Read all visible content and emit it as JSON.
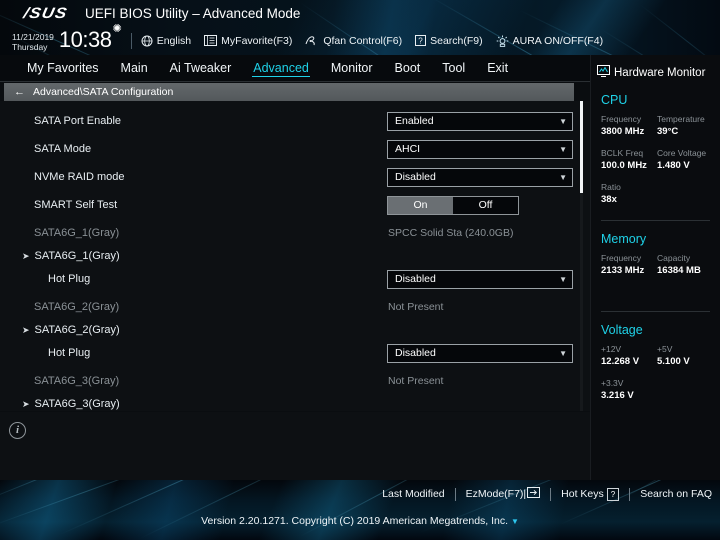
{
  "header": {
    "logo": "/SUS",
    "title": "UEFI BIOS Utility – Advanced Mode",
    "date": "11/21/2019",
    "weekday": "Thursday",
    "time": "10:38",
    "gear_icon": "gear-icon",
    "items": [
      {
        "icon": "globe-icon",
        "label": "English"
      },
      {
        "icon": "myfavorite-icon",
        "label": "MyFavorite(F3)"
      },
      {
        "icon": "qfan-icon",
        "label": "Qfan Control(F6)"
      },
      {
        "icon": "search-icon",
        "label": "Search(F9)"
      },
      {
        "icon": "aura-icon",
        "label": "AURA ON/OFF(F4)"
      }
    ]
  },
  "nav": {
    "tabs": [
      {
        "label": "My Favorites",
        "active": false
      },
      {
        "label": "Main",
        "active": false
      },
      {
        "label": "Ai Tweaker",
        "active": false
      },
      {
        "label": "Advanced",
        "active": true
      },
      {
        "label": "Monitor",
        "active": false
      },
      {
        "label": "Boot",
        "active": false
      },
      {
        "label": "Tool",
        "active": false
      },
      {
        "label": "Exit",
        "active": false
      }
    ],
    "accent": "#1fd2e8"
  },
  "breadcrumb": {
    "back_icon": "back-arrow-icon",
    "path": "Advanced\\SATA Configuration"
  },
  "settings": {
    "rows": [
      {
        "kind": "dropdown",
        "label": "SATA Port Enable",
        "value": "Enabled",
        "indent": 0,
        "dim": false
      },
      {
        "kind": "dropdown",
        "label": "SATA Mode",
        "value": "AHCI",
        "indent": 0,
        "dim": false
      },
      {
        "kind": "dropdown",
        "label": "NVMe RAID mode",
        "value": "Disabled",
        "indent": 0,
        "dim": false
      },
      {
        "kind": "toggle",
        "label": "SMART Self Test",
        "on_label": "On",
        "off_label": "Off",
        "selected": "On",
        "indent": 0,
        "dim": false
      },
      {
        "kind": "static",
        "label": "SATA6G_1(Gray)",
        "value": "SPCC Solid Sta (240.0GB)",
        "indent": 0,
        "dim": true
      },
      {
        "kind": "expand",
        "label": "SATA6G_1(Gray)",
        "caret": "submenu-caret-icon",
        "indent": 0,
        "dim": false
      },
      {
        "kind": "dropdown",
        "label": "Hot Plug",
        "value": "Disabled",
        "indent": 1,
        "dim": false
      },
      {
        "kind": "static",
        "label": "SATA6G_2(Gray)",
        "value": "Not Present",
        "indent": 0,
        "dim": true
      },
      {
        "kind": "expand",
        "label": "SATA6G_2(Gray)",
        "caret": "submenu-caret-icon",
        "indent": 0,
        "dim": false
      },
      {
        "kind": "dropdown",
        "label": "Hot Plug",
        "value": "Disabled",
        "indent": 1,
        "dim": false
      },
      {
        "kind": "static",
        "label": "SATA6G_3(Gray)",
        "value": "Not Present",
        "indent": 0,
        "dim": true
      },
      {
        "kind": "expand",
        "label": "SATA6G_3(Gray)",
        "caret": "submenu-caret-icon",
        "indent": 0,
        "dim": false
      }
    ]
  },
  "help": {
    "info_icon": "info-icon",
    "glyph": "i"
  },
  "sidebar": {
    "title": "Hardware Monitor",
    "title_icon": "monitor-icon",
    "groups": [
      {
        "name": "CPU",
        "pairs": [
          [
            {
              "key": "Frequency",
              "value": "3800 MHz"
            },
            {
              "key": "Temperature",
              "value": "39°C"
            }
          ],
          [
            {
              "key": "BCLK Freq",
              "value": "100.0 MHz"
            },
            {
              "key": "Core Voltage",
              "value": "1.480 V"
            }
          ],
          [
            {
              "key": "Ratio",
              "value": "38x"
            }
          ]
        ]
      },
      {
        "name": "Memory",
        "pairs": [
          [
            {
              "key": "Frequency",
              "value": "2133 MHz"
            },
            {
              "key": "Capacity",
              "value": "16384 MB"
            }
          ]
        ]
      },
      {
        "name": "Voltage",
        "pairs": [
          [
            {
              "key": "+12V",
              "value": "12.268 V"
            },
            {
              "key": "+5V",
              "value": "5.100 V"
            }
          ],
          [
            {
              "key": "+3.3V",
              "value": "3.216 V"
            }
          ]
        ]
      }
    ]
  },
  "footer": {
    "links": [
      {
        "label": "Last Modified",
        "icon": null
      },
      {
        "label": "EzMode(F7)|",
        "icon": "exit-arrow-icon"
      },
      {
        "label": "Hot Keys",
        "icon": "question-key-icon",
        "key": "?"
      },
      {
        "label": "Search on FAQ",
        "icon": null
      }
    ],
    "version": "Version 2.20.1271. Copyright (C) 2019 American Megatrends, Inc."
  }
}
